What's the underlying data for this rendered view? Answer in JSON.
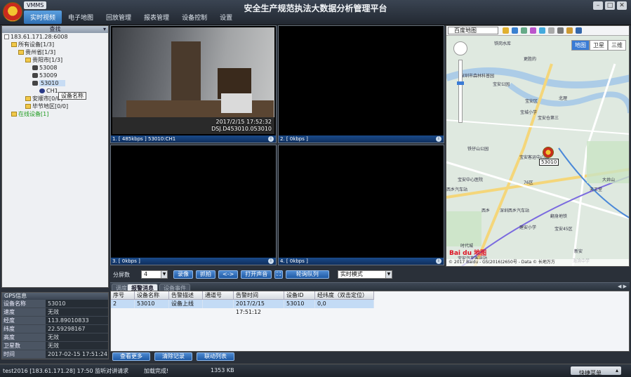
{
  "app": {
    "badge": "VMMS",
    "title": "安全生产规范执法大数据分析管理平台",
    "menu": [
      "实时视频",
      "电子地图",
      "回放管理",
      "报表管理",
      "设备控制",
      "设置"
    ],
    "window_controls": [
      "–",
      "□",
      "✕"
    ]
  },
  "tree": {
    "header": "查找",
    "items": [
      {
        "label": "183.61.171.28:6008",
        "indent": 0,
        "icon": "server-icon"
      },
      {
        "label": "所有设备[1/3]",
        "indent": 1,
        "icon": "folder-icon"
      },
      {
        "label": "贵州省[1/3]",
        "indent": 2,
        "icon": "folder-icon"
      },
      {
        "label": "贵阳市[1/3]",
        "indent": 3,
        "icon": "folder-icon"
      },
      {
        "label": "53008",
        "indent": 4,
        "icon": "car-icon"
      },
      {
        "label": "53009",
        "indent": 4,
        "icon": "car-icon"
      },
      {
        "label": "53010",
        "indent": 4,
        "icon": "car-icon"
      },
      {
        "label": "CH1",
        "indent": 5,
        "icon": "camera-icon"
      },
      {
        "label": "安顺市[0/0]",
        "indent": 3,
        "icon": "folder-icon"
      },
      {
        "label": "毕节地区[0/0]",
        "indent": 3,
        "icon": "folder-icon"
      },
      {
        "label": "在线设备[1]",
        "indent": 1,
        "icon": "folder-icon"
      }
    ],
    "tooltip": "设备名称"
  },
  "gps": {
    "header": "GPS信息",
    "rows": [
      {
        "k": "设备名称",
        "v": "53010"
      },
      {
        "k": "速度",
        "v": "无效"
      },
      {
        "k": "经度",
        "v": "113.89010833"
      },
      {
        "k": "纬度",
        "v": "22.59298167"
      },
      {
        "k": "高度",
        "v": "无效"
      },
      {
        "k": "卫星数",
        "v": "无效"
      },
      {
        "k": "时间",
        "v": "2017-02-15 17:51:24"
      }
    ]
  },
  "video": {
    "channels": [
      {
        "label": "1. [ 485kbps ] 53010:CH1",
        "live": true,
        "osd_time": "2017/2/15 17:52:32",
        "osd_id": "DSJ.D453010.053010"
      },
      {
        "label": "2. [ 0kbps ]",
        "live": false
      },
      {
        "label": "3. [ 0kbps ]",
        "live": false
      },
      {
        "label": "4. [ 0kbps ]",
        "live": false
      }
    ],
    "controls": {
      "split_label": "分屏数",
      "split_value": "4",
      "record": "录像",
      "snapshot": "抓拍",
      "swap": "<->",
      "sound": "打开声音",
      "patrol": "轮询队列",
      "mode": "实时模式"
    }
  },
  "map": {
    "provider": "百度地图",
    "types": [
      "地图",
      "卫星",
      "三维"
    ],
    "active_type": "地图",
    "marker": "53010",
    "logo": "Bai du 地图",
    "copyright": "© 2017 Baidu - GS(2016)2650号 - Data © 长地万方",
    "labels": [
      "铁岗水库",
      "更胜的",
      "深圳市森林科普园",
      "宝安公园",
      "宝安区",
      "北理",
      "宝城小学",
      "宝安仓第三",
      "铁仔山公园",
      "宝安客运中心站",
      "宝安中心医院",
      "76区",
      "大井山",
      "天王堂",
      "西乡",
      "西乡汽车站",
      "深圳西乡汽车站",
      "建安小学",
      "翻身地铁",
      "宝安45区",
      "新安",
      "宝安汽车客运站",
      "中安",
      "时代城",
      "1公里",
      "宝安82区",
      "海滨中学",
      "宝安艺术学"
    ]
  },
  "alarm": {
    "tabs": [
      "调度",
      "报警消息",
      "设备事件"
    ],
    "active_tab": "报警消息",
    "columns": [
      "序号",
      "设备名称",
      "告警描述",
      "通道号",
      "告警时间",
      "设备ID",
      "经纬度（双击定位）"
    ],
    "rows": [
      [
        "2",
        "53010",
        "设备上线",
        "",
        "2017/2/15 17:51:12",
        "53010",
        "0,0"
      ]
    ],
    "buttons": [
      "查看更多",
      "清除记录",
      "联动列表"
    ]
  },
  "status": {
    "user": "test2016 [183.61.171.28] 17:50 监听对讲请求",
    "loading": "加载完成!",
    "memory": "1353 KB",
    "quickmenu": "快捷菜单"
  }
}
